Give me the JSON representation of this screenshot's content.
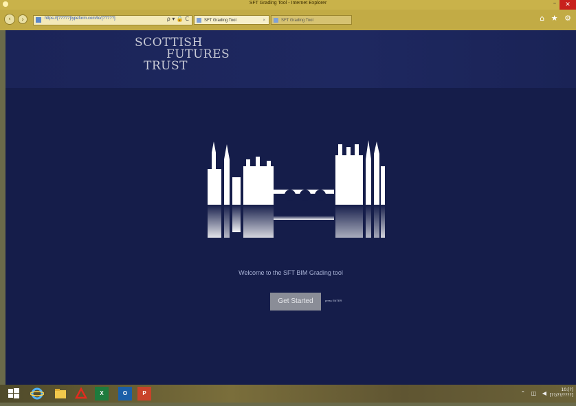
{
  "window": {
    "title": "SFT Grading Tool - Internet Explorer",
    "close_glyph": "✕",
    "minimize_glyph": "–"
  },
  "browser": {
    "back_glyph": "‹",
    "forward_glyph": "›",
    "address_url": "https://[?????]typeform.com/to/[?????]",
    "address_controls": "ρ ▾ 🔒 C",
    "tabs": [
      {
        "label": "SFT Grading Tool",
        "close": "×"
      },
      {
        "label": "SFT Grading Tool"
      }
    ],
    "right_icons": "⌂ ★ ⚙"
  },
  "page": {
    "logo_lines": [
      "SCOTTISH",
      "FUTURES",
      "TRUST"
    ],
    "welcome": "Welcome to the SFT BIM Grading tool",
    "start_button": "Get Started",
    "enter_hint": "press ENTER",
    "colors": {
      "background": "#151d4a",
      "button": "#8a8d97",
      "skyline": "#ffffff"
    }
  },
  "taskbar": {
    "apps": [
      {
        "icon": "windows-start-icon"
      },
      {
        "icon": "internet-explorer-icon"
      },
      {
        "icon": "file-explorer-icon"
      },
      {
        "icon": "acrobat-icon"
      },
      {
        "icon": "excel-icon",
        "label": "X"
      },
      {
        "icon": "outlook-icon",
        "label": "O"
      },
      {
        "icon": "powerpoint-icon",
        "label": "P"
      }
    ],
    "tray": "⌃ ◫ ◀",
    "clock_time": "10:[?]",
    "clock_date": "[??/??/????]"
  }
}
